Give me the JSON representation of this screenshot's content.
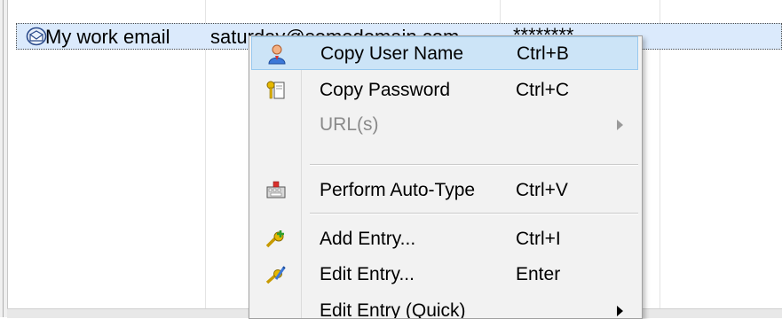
{
  "entry": {
    "title": "My work email",
    "username": "saturday@somedomain.com",
    "password": "********"
  },
  "context_menu": {
    "items": [
      {
        "label": "Copy User Name",
        "shortcut": "Ctrl+B",
        "icon": "user-icon",
        "highlighted": true
      },
      {
        "label": "Copy Password",
        "shortcut": "Ctrl+C",
        "icon": "key-icon"
      },
      {
        "label": "URL(s)",
        "shortcut": "",
        "icon": "",
        "disabled": true,
        "submenu": true
      },
      {
        "label": "Perform Auto-Type",
        "shortcut": "Ctrl+V",
        "icon": "keyboard-icon"
      },
      {
        "label": "Add Entry...",
        "shortcut": "Ctrl+I",
        "icon": "add-key-icon"
      },
      {
        "label": "Edit Entry...",
        "shortcut": "Enter",
        "icon": "edit-key-icon"
      },
      {
        "label": "Edit Entry (Quick)",
        "shortcut": "",
        "icon": "",
        "submenu": true
      }
    ]
  },
  "colors": {
    "selection": "#dbeafc",
    "menu_background": "#f2f2f2",
    "highlight": "#cce4f7",
    "highlight_border": "#99c9ef"
  }
}
